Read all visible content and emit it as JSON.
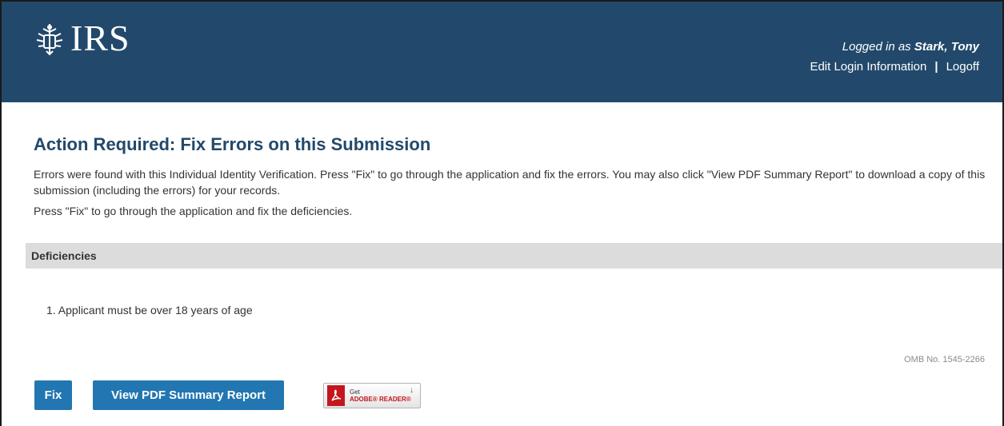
{
  "header": {
    "logo_text": "IRS",
    "logged_in_prefix": "Logged in as ",
    "user_name": "Stark, Tony",
    "edit_login_label": "Edit Login Information",
    "separator": "|",
    "logoff_label": "Logoff",
    "brand_color": "#22496b"
  },
  "main": {
    "title": "Action Required: Fix Errors on this Submission",
    "description": "Errors were found with this Individual Identity Verification. Press \"Fix\" to go through the application and fix the errors. You may also click \"View PDF Summary Report\" to download a copy of this submission (including the errors) for your records.",
    "instruction": "Press \"Fix\" to go through the application and fix the deficiencies.",
    "deficiencies_heading": "Deficiencies",
    "deficiencies": [
      "1. Applicant must be over 18 years of age"
    ],
    "omb_number": "OMB No. 1545-2266"
  },
  "actions": {
    "fix_label": "Fix",
    "pdf_label": "View PDF Summary Report",
    "button_color": "#2276b1"
  },
  "adobe_badge": {
    "get_text": "Get",
    "product_text": "ADOBE® READER®",
    "icon": "adobe-pdf-icon"
  }
}
